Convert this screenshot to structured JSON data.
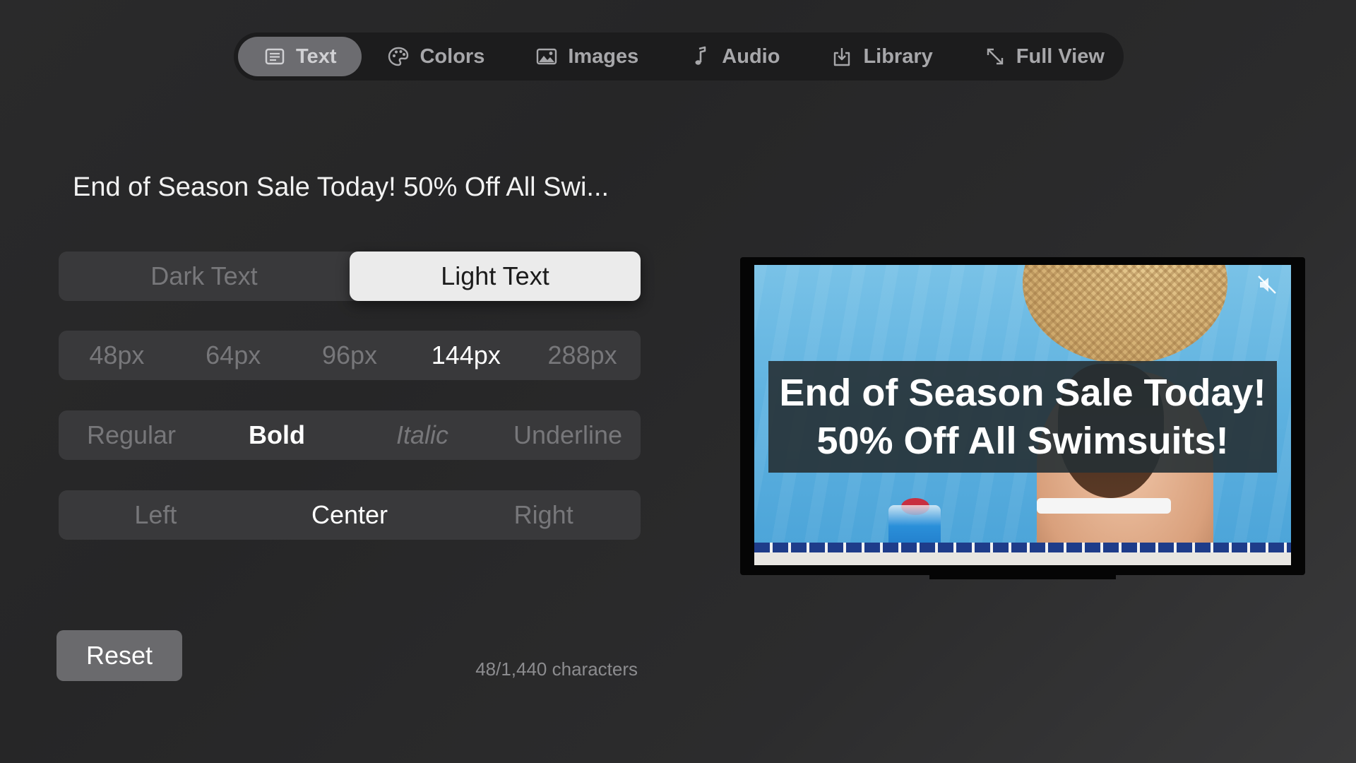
{
  "tabs": [
    {
      "label": "Text",
      "icon": "text-icon",
      "active": true
    },
    {
      "label": "Colors",
      "icon": "palette-icon",
      "active": false
    },
    {
      "label": "Images",
      "icon": "image-icon",
      "active": false
    },
    {
      "label": "Audio",
      "icon": "music-note-icon",
      "active": false
    },
    {
      "label": "Library",
      "icon": "download-tray-icon",
      "active": false
    },
    {
      "label": "Full View",
      "icon": "expand-arrows-icon",
      "active": false
    }
  ],
  "editor": {
    "headline": "End of Season Sale Today! 50% Off All Swi...",
    "theme_options": {
      "dark": "Dark Text",
      "light": "Light Text",
      "selected": "Light Text"
    },
    "size_options": [
      "48px",
      "64px",
      "96px",
      "144px",
      "288px"
    ],
    "size_selected": "144px",
    "style_options": [
      "Regular",
      "Bold",
      "Italic",
      "Underline"
    ],
    "style_selected": "Bold",
    "align_options": [
      "Left",
      "Center",
      "Right"
    ],
    "align_selected": "Center",
    "reset_label": "Reset",
    "char_count": "48/1,440 characters"
  },
  "preview": {
    "line1": "End of Season Sale Today!",
    "line2": "50% Off All Swimsuits!",
    "mute_icon": "speaker-muted-icon"
  }
}
